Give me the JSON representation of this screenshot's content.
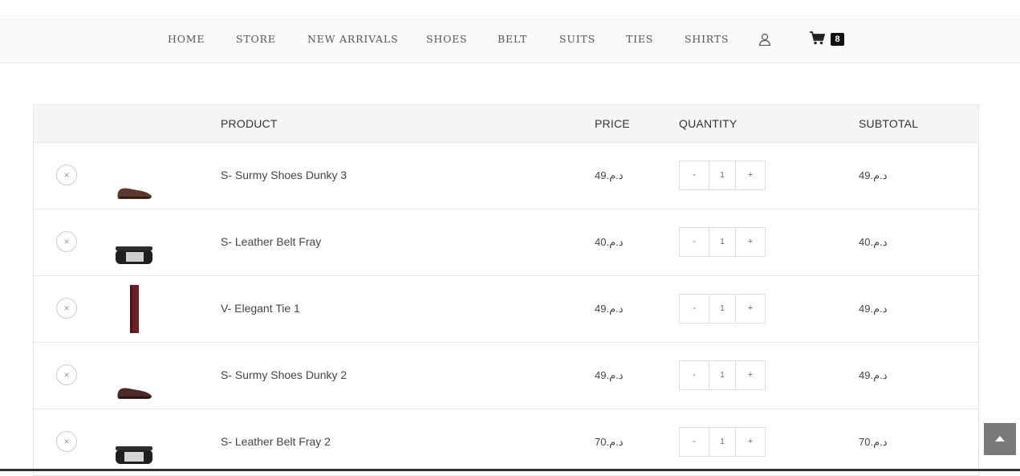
{
  "nav": {
    "items": [
      "HOME",
      "STORE",
      "NEW ARRIVALS",
      "SHOES",
      "BELT",
      "SUITS",
      "TIES",
      "SHIRTS"
    ],
    "account_icon": "user-icon",
    "cart_icon": "cart-icon",
    "cart_count": "8"
  },
  "table": {
    "headers": {
      "product": "PRODUCT",
      "price": "PRICE",
      "quantity": "QUANTITY",
      "subtotal": "SUBTOTAL"
    },
    "rows": [
      {
        "image": "shoe",
        "name": "S- Surmy Shoes Dunky 3",
        "price": "49.د.م",
        "qty": "1",
        "subtotal": "49.د.م"
      },
      {
        "image": "belt",
        "name": "S- Leather Belt Fray",
        "price": "40.د.م",
        "qty": "1",
        "subtotal": "40.د.م"
      },
      {
        "image": "tie",
        "name": "V- Elegant Tie 1",
        "price": "49.د.م",
        "qty": "1",
        "subtotal": "49.د.م"
      },
      {
        "image": "shoe",
        "name": "S- Surmy Shoes Dunky 2",
        "price": "49.د.م",
        "qty": "1",
        "subtotal": "49.د.م"
      },
      {
        "image": "belt",
        "name": "S- Leather Belt Fray 2",
        "price": "70.د.م",
        "qty": "1",
        "subtotal": "70.د.م"
      }
    ],
    "remove_symbol": "×",
    "minus": "-",
    "plus": "+"
  },
  "scroll_top_icon": "chevron-up-icon"
}
